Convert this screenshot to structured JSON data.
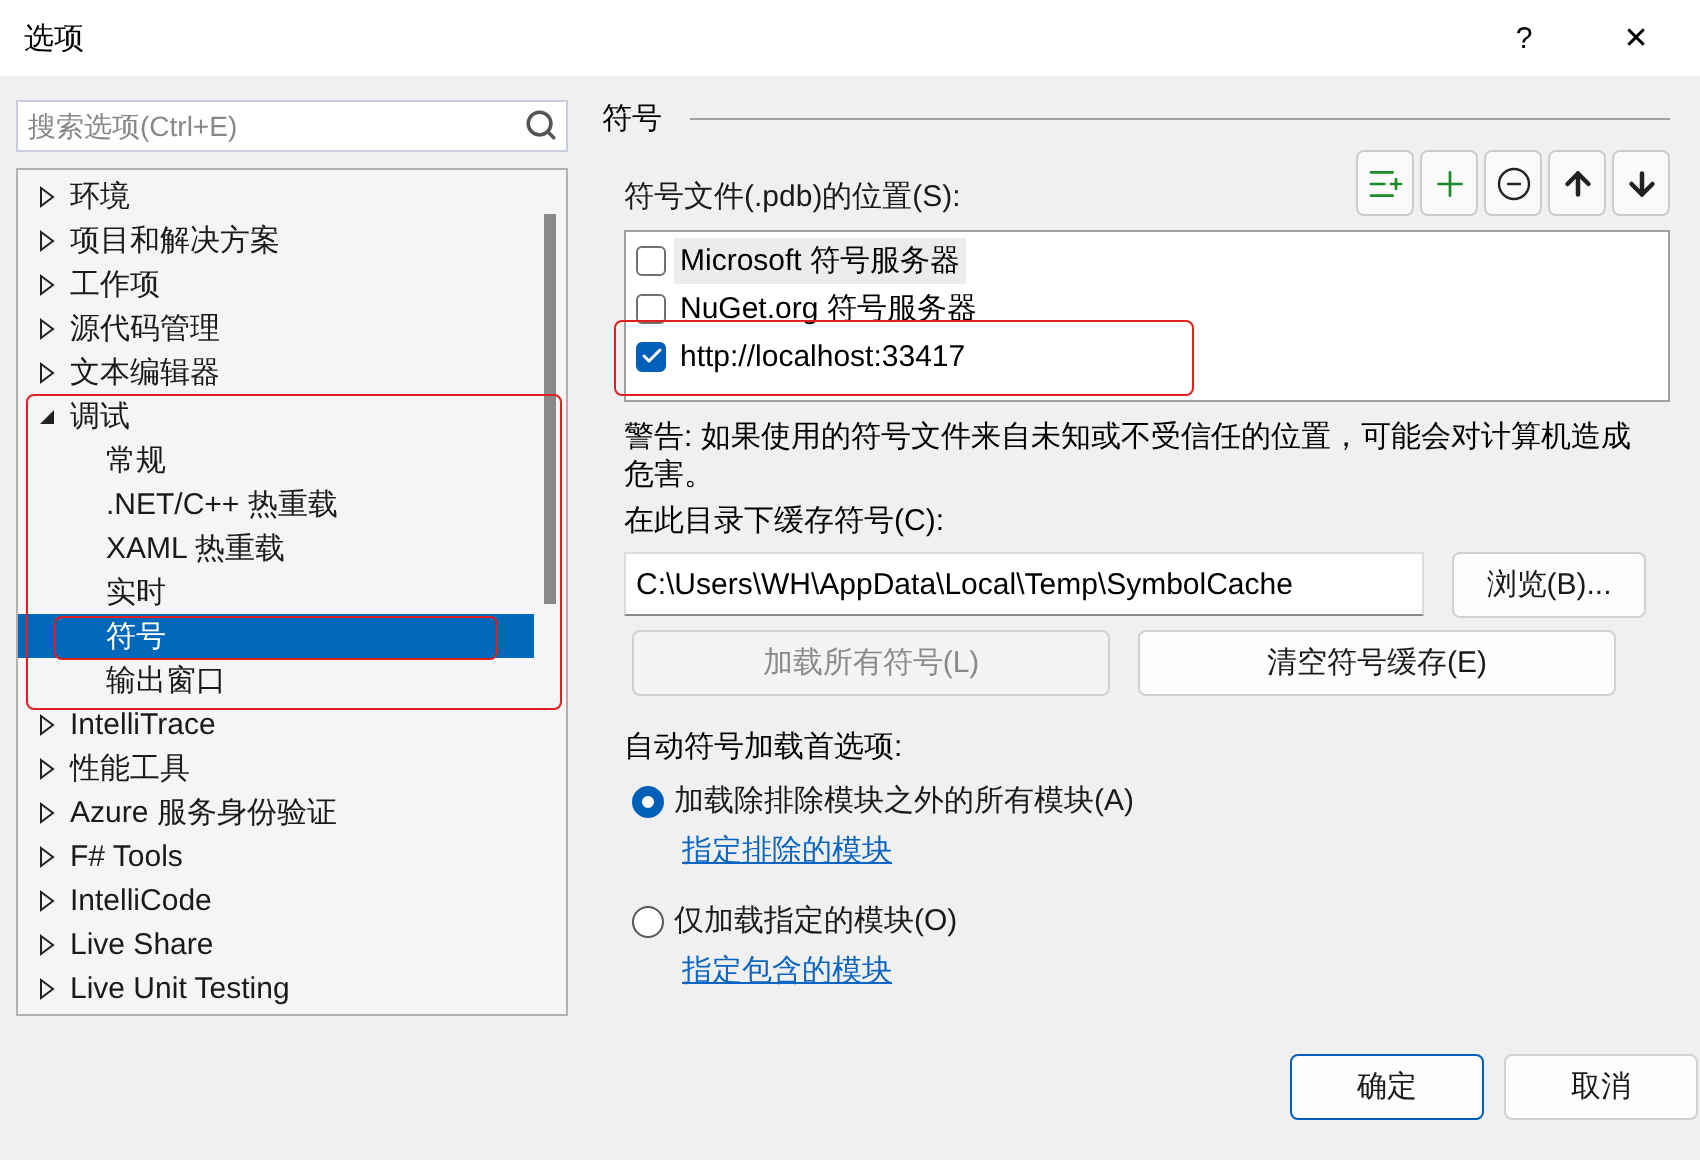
{
  "window": {
    "title": "选项",
    "help": "?",
    "close": "✕"
  },
  "search": {
    "placeholder": "搜索选项(Ctrl+E)"
  },
  "tree": [
    {
      "label": "环境",
      "expanded": false,
      "selected": false
    },
    {
      "label": "项目和解决方案",
      "expanded": false,
      "selected": false
    },
    {
      "label": "工作项",
      "expanded": false,
      "selected": false
    },
    {
      "label": "源代码管理",
      "expanded": false,
      "selected": false
    },
    {
      "label": "文本编辑器",
      "expanded": false,
      "selected": false
    },
    {
      "label": "调试",
      "expanded": true,
      "selected": false,
      "annotated": true,
      "children": [
        {
          "label": "常规",
          "selected": false
        },
        {
          "label": ".NET/C++ 热重载",
          "selected": false
        },
        {
          "label": "XAML 热重载",
          "selected": false
        },
        {
          "label": "实时",
          "selected": false
        },
        {
          "label": "符号",
          "selected": true,
          "annotated": true
        },
        {
          "label": "输出窗口",
          "selected": false
        }
      ]
    },
    {
      "label": "IntelliTrace",
      "expanded": false,
      "selected": false
    },
    {
      "label": "性能工具",
      "expanded": false,
      "selected": false
    },
    {
      "label": "Azure 服务身份验证",
      "expanded": false,
      "selected": false
    },
    {
      "label": "F# Tools",
      "expanded": false,
      "selected": false
    },
    {
      "label": "IntelliCode",
      "expanded": false,
      "selected": false
    },
    {
      "label": "Live Share",
      "expanded": false,
      "selected": false
    },
    {
      "label": "Live Unit Testing",
      "expanded": false,
      "selected": false
    }
  ],
  "panel": {
    "heading": "符号",
    "locations_label": "符号文件(.pdb)的位置(S):",
    "locations": [
      {
        "label": "Microsoft 符号服务器",
        "checked": false,
        "selected": true
      },
      {
        "label": "NuGet.org 符号服务器",
        "checked": false,
        "selected": false
      },
      {
        "label": "http://localhost:33417",
        "checked": true,
        "selected": false,
        "annotated": true
      }
    ],
    "warning": "警告: 如果使用的符号文件来自未知或不受信任的位置，可能会对计算机造成危害。",
    "cache_label": "在此目录下缓存符号(C):",
    "cache_path": "C:\\Users\\WH\\AppData\\Local\\Temp\\SymbolCache",
    "browse": "浏览(B)...",
    "actions": [
      {
        "label": "加载所有符号(L)",
        "disabled": true
      },
      {
        "label": "清空符号缓存(E)",
        "disabled": false
      }
    ],
    "auto_label": "自动符号加载首选项:",
    "options": [
      {
        "label": "加载除排除模块之外的所有模块(A)",
        "selected": true,
        "link": "指定排除的模块"
      },
      {
        "label": "仅加载指定的模块(O)",
        "selected": false,
        "link": "指定包含的模块"
      }
    ]
  },
  "buttons": [
    {
      "label": "确定",
      "default": true
    },
    {
      "label": "取消",
      "default": false
    }
  ]
}
